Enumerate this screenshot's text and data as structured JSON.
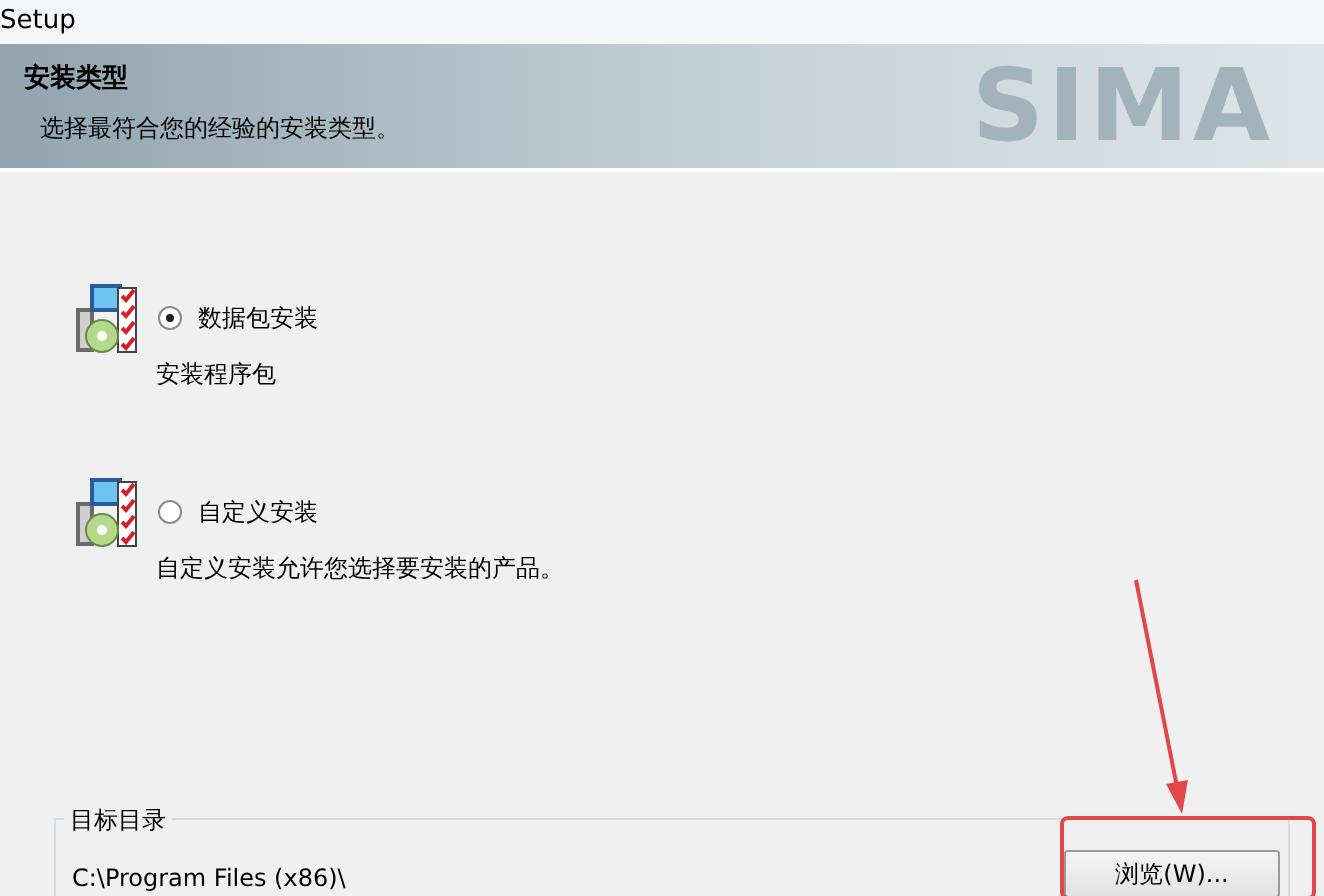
{
  "window": {
    "title": "Setup"
  },
  "header": {
    "title": "安装类型",
    "subtitle": "选择最符合您的经验的安装类型。",
    "logo_text": "SIMA"
  },
  "options": [
    {
      "label": "数据包安装",
      "description": "安装程序包",
      "selected": true
    },
    {
      "label": "自定义安装",
      "description": "自定义安装允许您选择要安装的产品。",
      "selected": false
    }
  ],
  "destination": {
    "legend": "目标目录",
    "path": "C:\\Program Files (x86)\\",
    "browse_button": "浏览(W)..."
  },
  "annotations": {
    "arrow": true,
    "frame": true
  }
}
